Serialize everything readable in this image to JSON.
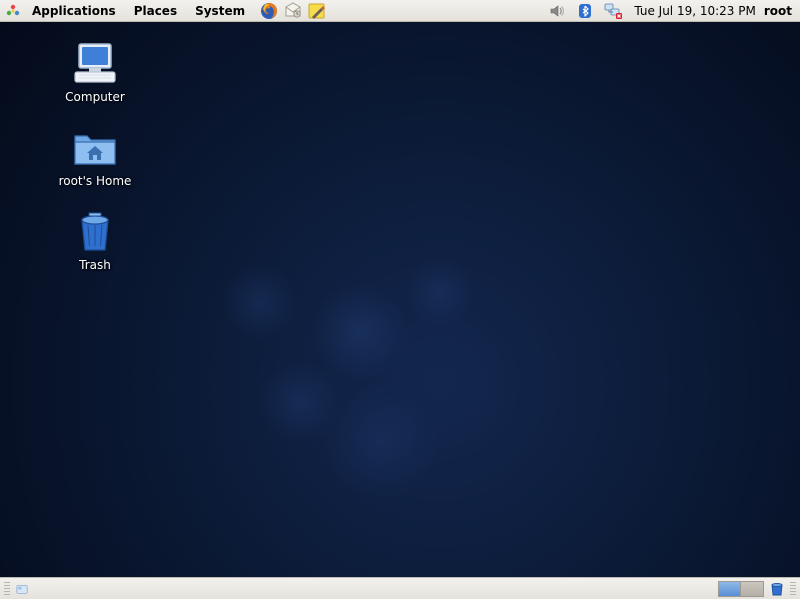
{
  "panel": {
    "menus": {
      "applications": "Applications",
      "places": "Places",
      "system": "System"
    },
    "clock": "Tue Jul 19, 10:23 PM",
    "user": "root"
  },
  "desktop": {
    "computer": "Computer",
    "home": "root's Home",
    "trash": "Trash"
  },
  "workspace": {
    "count": 2,
    "active": 0
  },
  "colors": {
    "panel_bg": "#eceae6",
    "accent": "#2f6fcf"
  }
}
